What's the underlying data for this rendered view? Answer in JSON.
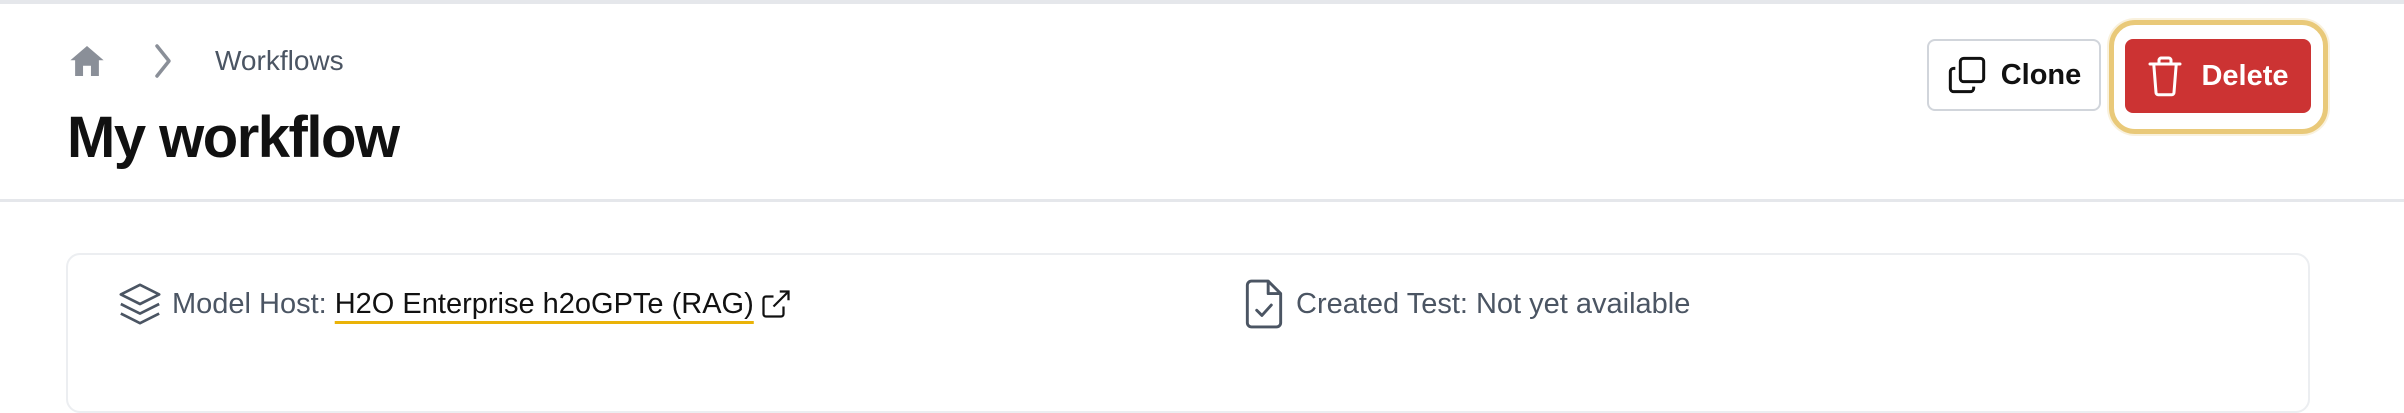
{
  "breadcrumb": {
    "home_icon": "home-icon",
    "separator_icon": "chevron-right-icon",
    "link": "Workflows"
  },
  "page": {
    "title": "My workflow"
  },
  "actions": {
    "clone_label": "Clone",
    "clone_icon": "copy-icon",
    "delete_label": "Delete",
    "delete_icon": "trash-icon"
  },
  "info": {
    "model_host_label": "Model Host:",
    "model_host_value": "H2O Enterprise h2oGPTe (RAG)",
    "model_host_icon": "layers-icon",
    "external_link_icon": "external-link-icon",
    "created_test_label": "Created Test:",
    "created_test_value": "Not yet available",
    "created_test_icon": "file-check-icon"
  },
  "colors": {
    "danger": "#cc3333",
    "focus_ring": "#e9c979",
    "link_underline": "#eab308",
    "muted_text": "#4b5563"
  }
}
